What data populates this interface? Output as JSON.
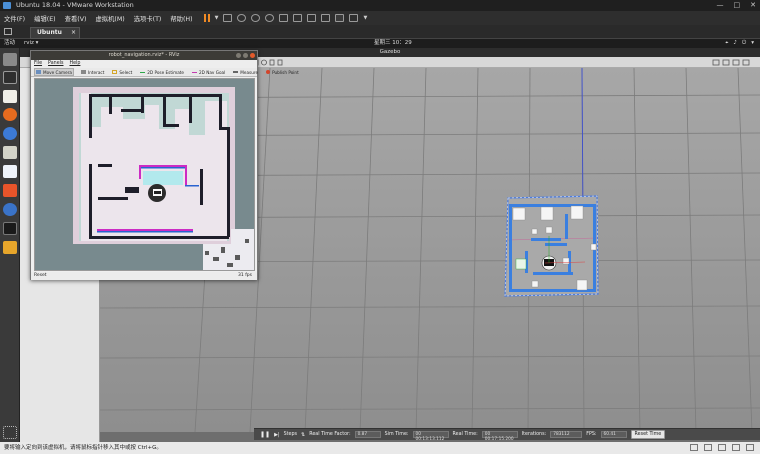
{
  "vmware": {
    "title": "Ubuntu 18.04 - VMware Workstation",
    "menus": [
      "文件(F)",
      "编辑(E)",
      "查看(V)",
      "虚拟机(M)",
      "选项卡(T)",
      "帮助(H)"
    ],
    "home_tab": "",
    "tab": "Ubuntu 18.04",
    "status_text": "要将输入定向到该虚拟机，请将鼠标指针移入其中或按 Ctrl+G。"
  },
  "ubuntu": {
    "activities": "活动",
    "app": "rviz",
    "clock": "星期三 10：29"
  },
  "gazebo": {
    "title": "Gazebo",
    "status": {
      "steps": "Steps",
      "rtf_label": "Real Time Factor:",
      "rtf_value": "0.87",
      "sim_label": "Sim Time:",
      "sim_value": "00 00:13:13.112",
      "real_label": "Real Time:",
      "real_value": "00 00:17:15.200",
      "iter_label": "Iterations:",
      "iter_value": "783112",
      "fps_label": "FPS:",
      "fps_value": "60.41",
      "reset": "Reset Time"
    }
  },
  "rviz": {
    "title": "robot_navigation.rviz* - RViz",
    "menus": [
      "File",
      "Panels",
      "Help"
    ],
    "tools": [
      {
        "label": "Move Camera",
        "icon": "move-camera-icon",
        "color": "#6a8fbf",
        "active": true
      },
      {
        "label": "Interact",
        "icon": "interact-icon",
        "color": "#888888",
        "active": false
      },
      {
        "label": "Select",
        "icon": "select-icon",
        "color": "#d4a62a",
        "active": false
      },
      {
        "label": "2D Pose Estimate",
        "icon": "pose-estimate-icon",
        "color": "#2ea84a",
        "active": false
      },
      {
        "label": "2D Nav Goal",
        "icon": "nav-goal-icon",
        "color": "#c43bb0",
        "active": false
      },
      {
        "label": "Measure",
        "icon": "measure-icon",
        "color": "#666666",
        "active": false
      },
      {
        "label": "Publish Point",
        "icon": "publish-point-icon",
        "color": "#d3452b",
        "active": false
      }
    ],
    "reset": "Reset",
    "fps": "31 fps"
  }
}
